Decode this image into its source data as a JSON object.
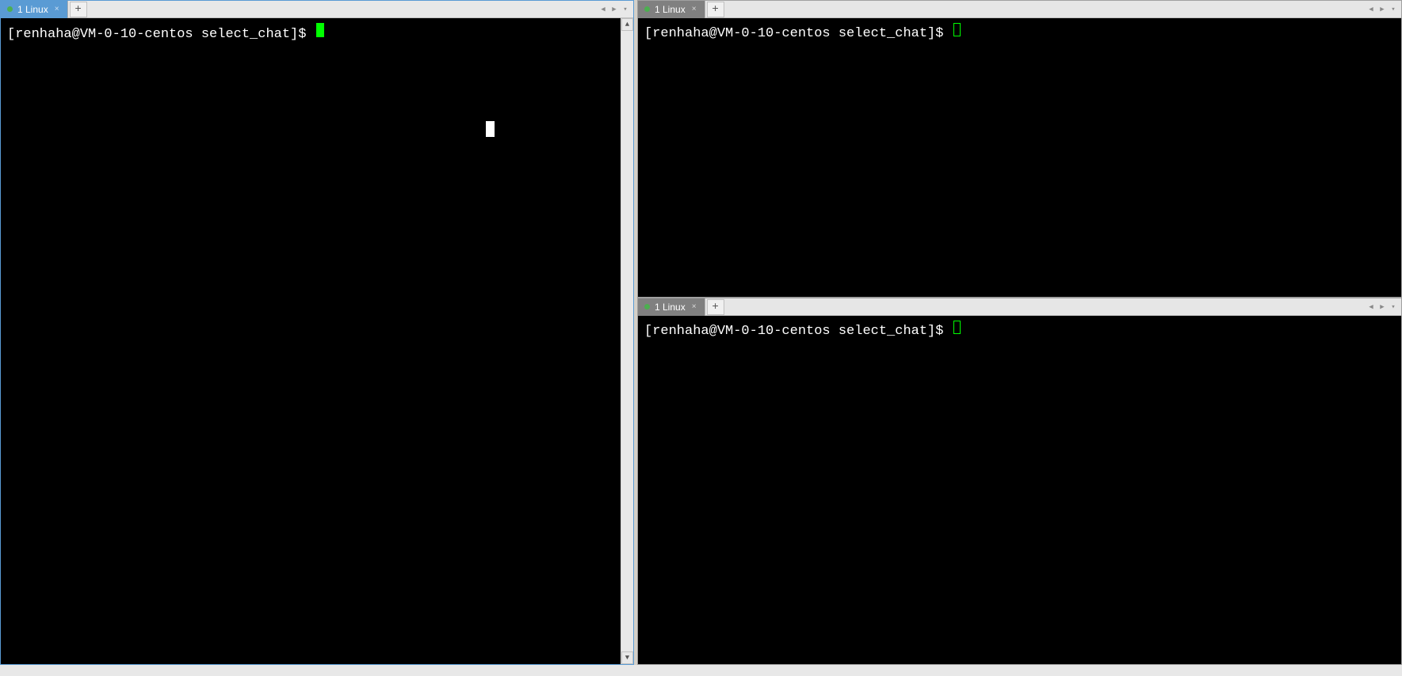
{
  "panes": {
    "left": {
      "tab": {
        "label": "1 Linux",
        "status_color": "#4caf50"
      },
      "prompt": "[renhaha@VM-0-10-centos select_chat]$ ",
      "cursor_style": "block-filled",
      "active": true
    },
    "right_top": {
      "tab": {
        "label": "1 Linux",
        "status_color": "#4caf50"
      },
      "prompt": "[renhaha@VM-0-10-centos select_chat]$ ",
      "cursor_style": "box-outline",
      "active": false
    },
    "right_bottom": {
      "tab": {
        "label": "1 Linux",
        "status_color": "#4caf50"
      },
      "prompt": "[renhaha@VM-0-10-centos select_chat]$ ",
      "cursor_style": "box-outline",
      "active": false
    }
  },
  "icons": {
    "close": "×",
    "add": "+",
    "left_arrow": "◀",
    "right_arrow": "▶",
    "dropdown": "▾",
    "up": "▲",
    "down": "▼"
  }
}
